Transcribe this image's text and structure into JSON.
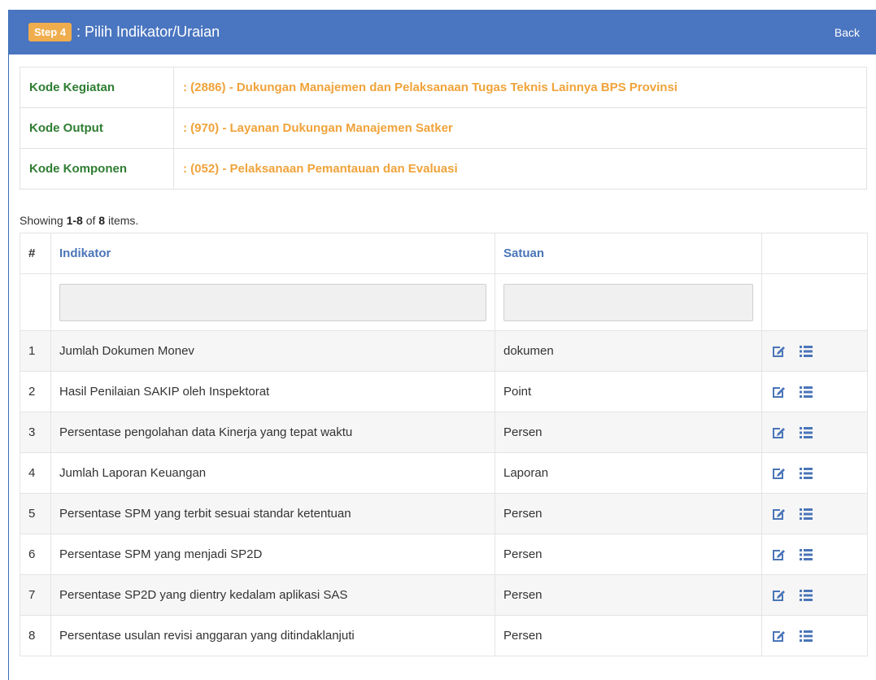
{
  "header": {
    "step_badge": "Step 4",
    "title": ": Pilih Indikator/Uraian",
    "back_label": "Back"
  },
  "info": [
    {
      "label": "Kode Kegiatan",
      "value": ": (2886) - Dukungan Manajemen dan Pelaksanaan Tugas Teknis Lainnya BPS Provinsi"
    },
    {
      "label": "Kode Output",
      "value": ": (970) - Layanan Dukungan Manajemen Satker"
    },
    {
      "label": "Kode Komponen",
      "value": ": (052) - Pelaksanaan Pemantauan dan Evaluasi"
    }
  ],
  "summary": {
    "prefix": "Showing ",
    "range": "1-8",
    "of": " of ",
    "total": "8",
    "suffix": " items."
  },
  "table": {
    "columns": {
      "num": "#",
      "indikator": "Indikator",
      "satuan": "Satuan"
    },
    "rows": [
      {
        "no": "1",
        "indikator": "Jumlah Dokumen Monev",
        "satuan": "dokumen"
      },
      {
        "no": "2",
        "indikator": "Hasil Penilaian SAKIP oleh Inspektorat",
        "satuan": "Point"
      },
      {
        "no": "3",
        "indikator": "Persentase pengolahan data Kinerja yang tepat waktu",
        "satuan": "Persen"
      },
      {
        "no": "4",
        "indikator": "Jumlah Laporan Keuangan",
        "satuan": "Laporan"
      },
      {
        "no": "5",
        "indikator": "Persentase SPM yang terbit sesuai standar ketentuan",
        "satuan": "Persen"
      },
      {
        "no": "6",
        "indikator": "Persentase SPM yang menjadi SP2D",
        "satuan": "Persen"
      },
      {
        "no": "7",
        "indikator": "Persentase SP2D yang dientry kedalam aplikasi SAS",
        "satuan": "Persen"
      },
      {
        "no": "8",
        "indikator": "Persentase usulan revisi anggaran yang ditindaklanjuti",
        "satuan": "Persen"
      }
    ]
  },
  "icons": {
    "edit": "edit-icon",
    "list": "list-icon",
    "color": "#4a75b8"
  },
  "colors": {
    "header_bg": "#4a75c0",
    "badge": "#f0ad4e",
    "label_green": "#2f7d32",
    "value_orange": "#f0a33a"
  }
}
